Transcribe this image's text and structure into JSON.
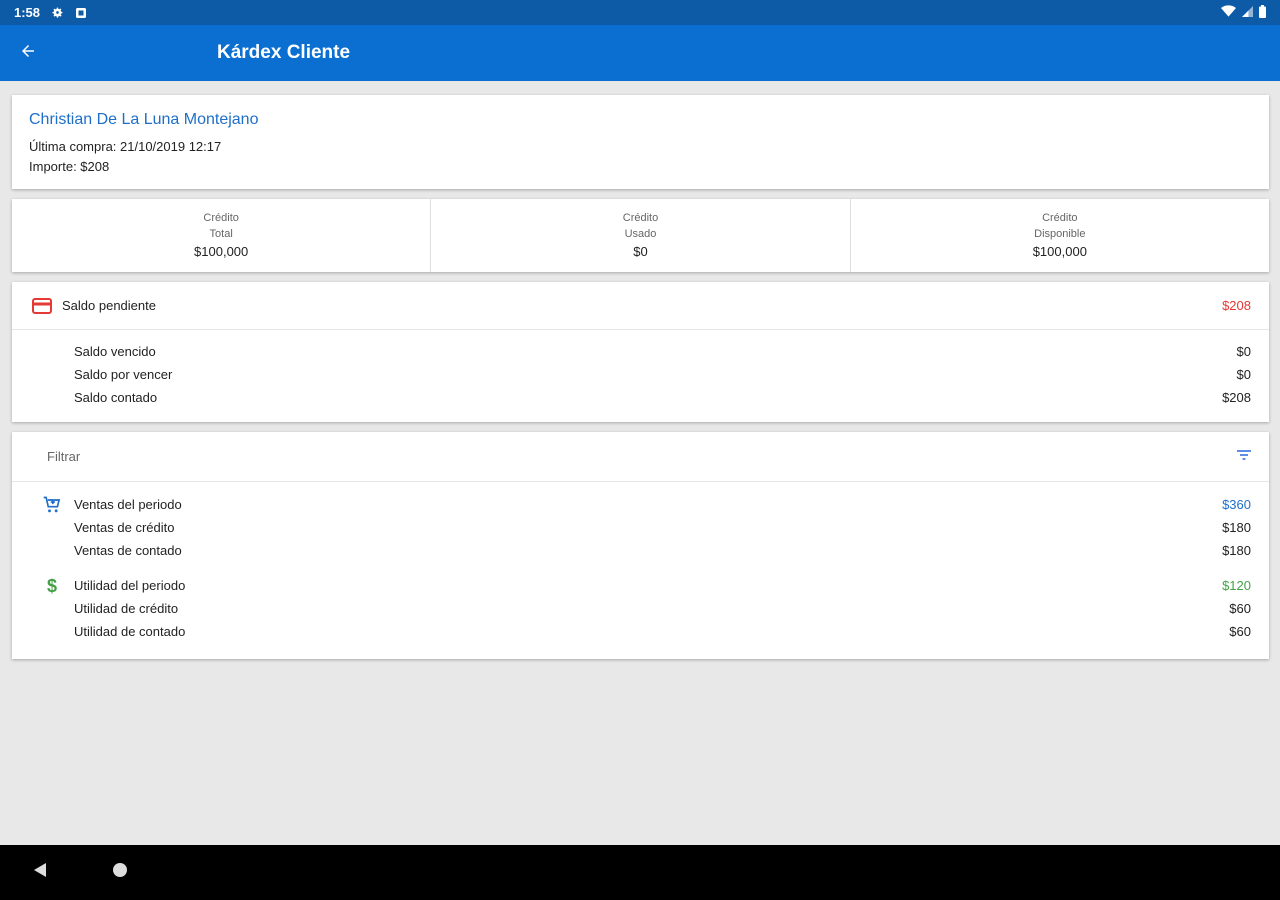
{
  "status_bar": {
    "time": "1:58"
  },
  "app_bar": {
    "title": "Kárdex Cliente"
  },
  "customer": {
    "name": "Christian De La Luna Montejano",
    "last_purchase": "Última compra: 21/10/2019 12:17",
    "amount": "Importe: $208"
  },
  "credit": [
    {
      "label1": "Crédito",
      "label2": "Total",
      "value": "$100,000"
    },
    {
      "label1": "Crédito",
      "label2": "Usado",
      "value": "$0"
    },
    {
      "label1": "Crédito",
      "label2": "Disponible",
      "value": "$100,000"
    }
  ],
  "balance": {
    "label": "Saldo pendiente",
    "amount": "$208",
    "rows": [
      {
        "label": "Saldo vencido",
        "value": "$0"
      },
      {
        "label": "Saldo por vencer",
        "value": "$0"
      },
      {
        "label": "Saldo contado",
        "value": "$208"
      }
    ]
  },
  "period": {
    "filter_label": "Filtrar",
    "sales": [
      {
        "label": "Ventas del periodo",
        "value": "$360"
      },
      {
        "label": "Ventas de crédito",
        "value": "$180"
      },
      {
        "label": "Ventas de contado",
        "value": "$180"
      }
    ],
    "profit": [
      {
        "label": "Utilidad del periodo",
        "value": "$120"
      },
      {
        "label": "Utilidad de crédito",
        "value": "$60"
      },
      {
        "label": "Utilidad de contado",
        "value": "$60"
      }
    ]
  },
  "colors": {
    "app_bar": "#0a6fd1",
    "status_bar": "#0d5aa7",
    "name_blue": "#1f6fc9",
    "balance_red": "#e53935",
    "sales_blue": "#1f6fc9",
    "profit_green": "#43a047"
  },
  "icons": {
    "back": "arrow-left-icon",
    "balance": "credit-card-icon",
    "filter": "filter-icon",
    "sales": "cart-icon",
    "profit": "dollar-icon"
  }
}
